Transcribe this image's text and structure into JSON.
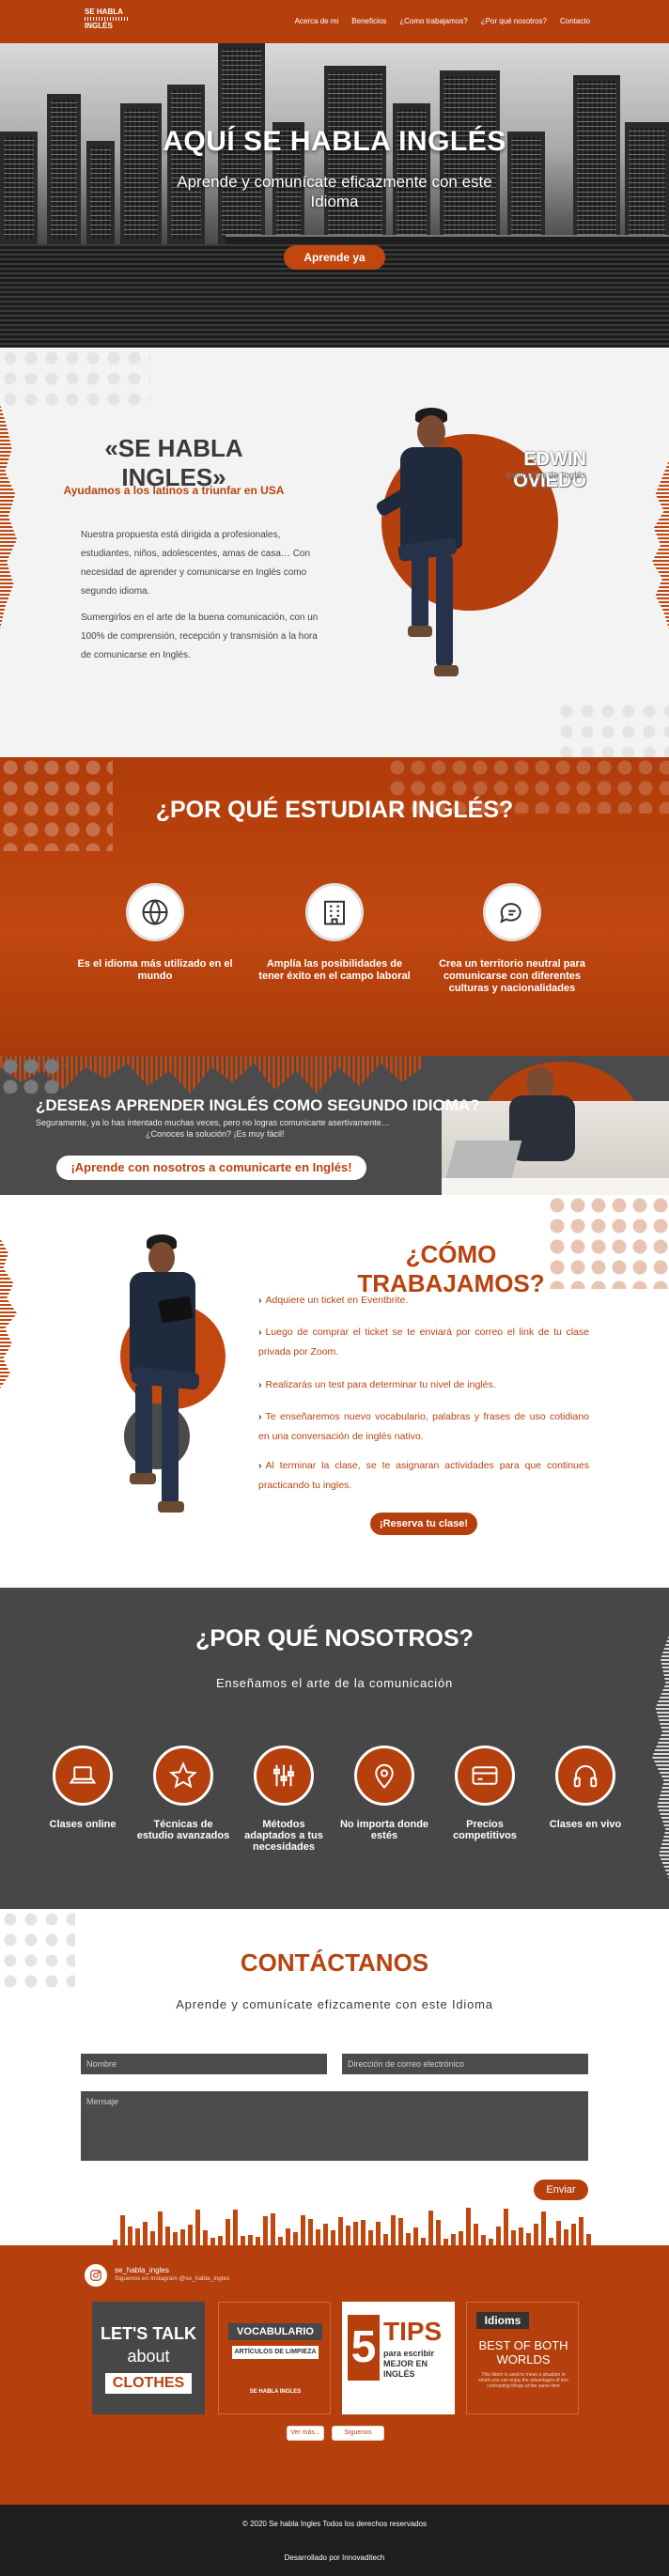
{
  "header": {
    "logo": {
      "line1": "SE HABLA",
      "line2": "INGLÉS"
    },
    "nav": [
      "Acerca de mi",
      "Beneficios",
      "¿Como trabajamos?",
      "¿Por qué nosotros?",
      "Contacto"
    ]
  },
  "hero": {
    "title": "AQUÍ SE HABLA INGLÉS",
    "subtitle": "Aprende y comunícate eficazmente con este Idioma",
    "button": "Aprende ya"
  },
  "intro": {
    "title": "«SE HABLA INGLES»",
    "subtitle": "Ayudamos a los latinos a triunfar en USA",
    "p1": "Nuestra propuesta está dirigida a profesionales, estudiantes, niños, adolescentes, amas de casa… Con necesidad de aprender y comunicarse en Inglés como segundo idioma.",
    "p2": "Sumergirlos en el arte de la buena comunicación, con un 100% de comprensión, recepción y transmisión a la hora de comunicarse en Inglés.",
    "name": "EDWIN OVIEDO",
    "role": "Instructor de Inglés"
  },
  "why": {
    "title": "¿POR QUÉ ESTUDIAR INGLÉS?",
    "items": [
      {
        "icon": "globe-icon",
        "text": "Es el idioma más utilizado en el mundo"
      },
      {
        "icon": "building-icon",
        "text": "Amplía las posibilidades de tener éxito en el campo laboral"
      },
      {
        "icon": "chat-icon",
        "text": "Crea un territorio neutral para comunicarse con diferentes culturas y nacionalidades"
      }
    ]
  },
  "banner": {
    "title": "¿DESEAS APRENDER INGLÉS COMO SEGUNDO IDIOMA?",
    "sub1": "Seguramente, ya lo has intentado muchas veces, pero no logras comunicarte asertivamente…",
    "sub2": "¿Conoces la solución? ¡Es muy fácil!",
    "button": "¡Aprende con nosotros a comunicarte en Inglés!"
  },
  "how": {
    "title": "¿CÓMO TRABAJAMOS?",
    "steps": [
      "Adquiere un ticket en Eventbrite.",
      "Luego de comprar el ticket se te enviará por correo el link de tu clase privada por Zoom.",
      "Realizarás un test para determinar tu nivel de inglés.",
      "Te enseñaremos nuevo vocabulario, palabras y frases de uso cotidiano en una conversación de inglés nativo.",
      "Al terminar la clase, se te asignaran actividades para que continues practicando tu ingles."
    ],
    "button": "¡Reserva tu clase!"
  },
  "us": {
    "title": "¿POR QUÉ NOSOTROS?",
    "subtitle": "Enseñamos el arte de la comunicación",
    "items": [
      {
        "icon": "laptop-icon",
        "text": "Clases online"
      },
      {
        "icon": "star-icon",
        "text": "Técnicas de estudio avanzados"
      },
      {
        "icon": "sliders-icon",
        "text": "Métodos adaptados a tus necesidades"
      },
      {
        "icon": "map-pin-icon",
        "text": "No importa donde estés"
      },
      {
        "icon": "credit-card-icon",
        "text": "Precios competitivos"
      },
      {
        "icon": "headphones-icon",
        "text": "Clases en vivo"
      }
    ]
  },
  "contact": {
    "title": "CONTÁCTANOS",
    "subtitle": "Aprende y comunícate efizcamente con este Idioma",
    "name_placeholder": "Nombre",
    "email_placeholder": "Dirección de correo electrónico",
    "message_placeholder": "Mensaje",
    "send": "Enviar"
  },
  "instagram": {
    "handle": "se_habla_ingles",
    "sub": "Siguenos en Instagram @se_habla_ingles",
    "posts": [
      {
        "l1": "LET'S TALK",
        "l2": "about",
        "l3": "CLOTHES"
      },
      {
        "l1": "VOCABULARIO",
        "l2": "ARTÍCULOS DE LIMPIEZA",
        "l3": "SE HABLA INGLES"
      },
      {
        "l1": "5",
        "l2": "TIPS",
        "l3": "para escribir MEJOR EN INGLÉS"
      },
      {
        "l1": "Idioms",
        "l2": "BEST OF BOTH WORLDS",
        "l3": "This Idiom is used to mean a situation in which you can enjoy the advantages of two contrasting things at the same time"
      }
    ],
    "more": "Ver más...",
    "follow": "Siguenos"
  },
  "footer": {
    "copyright": "© 2020 Se habla Ingles Todos los derechos reservados",
    "developer": "Desarrollado por Innovaditech"
  },
  "colors": {
    "brand": "#b5400e",
    "dark": "#474747",
    "footer": "#1e1e1e"
  }
}
